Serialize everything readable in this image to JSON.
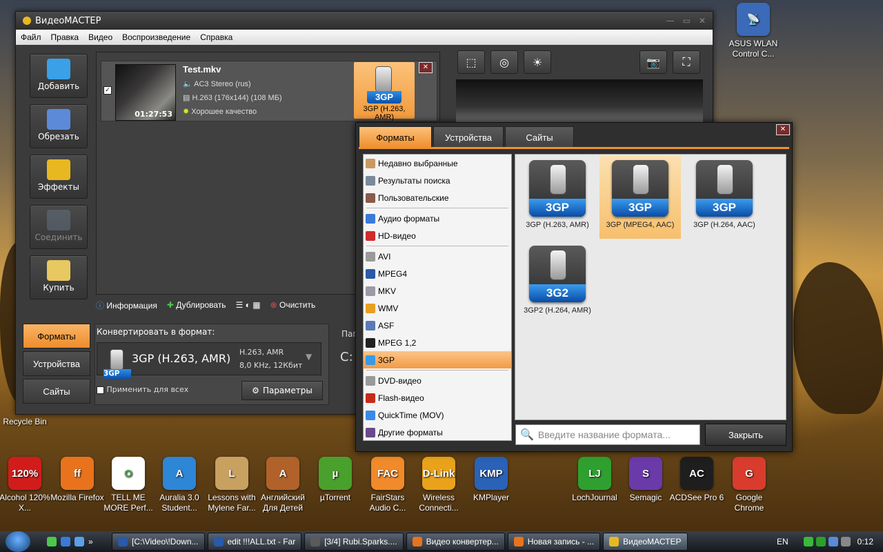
{
  "desktop": {
    "icons_top_right": [
      "ASUS WLAN Control C..."
    ],
    "icons_left": [
      "Recycle Bin"
    ],
    "icons_bottom": [
      {
        "label": "Alcohol 120% X...",
        "color": "#d21c1c",
        "glyph": "120%"
      },
      {
        "label": "Mozilla Firefox",
        "color": "#e8731c",
        "glyph": "ff"
      },
      {
        "label": "TELL ME MORE Perf...",
        "color": "#ffffff",
        "glyph": "O"
      },
      {
        "label": "Auralia 3.0 Student...",
        "color": "#2d86d6",
        "glyph": "A"
      },
      {
        "label": "Lessons with Mylene Far...",
        "color": "#c8a060",
        "glyph": "L"
      },
      {
        "label": "Английский Для Детей",
        "color": "#b0622a",
        "glyph": "A"
      },
      {
        "label": "µTorrent",
        "color": "#4aa02c",
        "glyph": "µ"
      },
      {
        "label": "FairStars Audio C...",
        "color": "#f08a2a",
        "glyph": "FAC"
      },
      {
        "label": "Wireless Connecti...",
        "color": "#e9a21a",
        "glyph": "D-Link"
      },
      {
        "label": "KMPlayer",
        "color": "#2a62b8",
        "glyph": "KMP"
      },
      {
        "label": "LochJournal",
        "color": "#2fa02f",
        "glyph": "LJ"
      },
      {
        "label": "Semagic",
        "color": "#6a3aa8",
        "glyph": "S"
      },
      {
        "label": "ACDSee Pro 6",
        "color": "#1e1e1e",
        "glyph": "AC"
      },
      {
        "label": "Google Chrome",
        "color": "#d93c2c",
        "glyph": "G"
      }
    ]
  },
  "main": {
    "title": "ВидеоМАСТЕР",
    "menu": [
      "Файл",
      "Правка",
      "Видео",
      "Воспроизведение",
      "Справка"
    ],
    "tools": [
      {
        "label": "Добавить",
        "color": "#3aa0e8",
        "enabled": true
      },
      {
        "label": "Обрезать",
        "color": "#5c8ad8",
        "enabled": true
      },
      {
        "label": "Эффекты",
        "color": "#e8b820",
        "enabled": true
      },
      {
        "label": "Соединить",
        "color": "#6a7a8a",
        "enabled": false
      },
      {
        "label": "Купить",
        "color": "#e8c860",
        "enabled": true
      }
    ],
    "file": {
      "name": "Test.mkv",
      "audio": "AC3 Stereo (rus)",
      "video": "H.263 (176x144) (108 МБ)",
      "quality": "Хорошее качество",
      "duration": "01:27:53"
    },
    "format_badge": {
      "label": "3GP (H.263, AMR)",
      "icon_text": "3GP"
    },
    "bottom_actions": [
      "Информация",
      "Дублировать",
      "Очистить"
    ],
    "conv_tabs": [
      "Форматы",
      "Устройства",
      "Сайты"
    ],
    "convert_label": "Конвертировать в формат:",
    "convert_format": "3GP (H.263, AMR)",
    "convert_codec": "H.263, AMR",
    "convert_audio": "8,0 KHz, 12Кбит",
    "apply_all": "Применить для всех",
    "params_button": "Параметры",
    "folder_partial": "Пап",
    "path_partial": "C:"
  },
  "dialog": {
    "tabs": [
      "Форматы",
      "Устройства",
      "Сайты"
    ],
    "categories": [
      {
        "label": "Недавно выбранные",
        "color": "#c89a60",
        "group": 1
      },
      {
        "label": "Результаты поиска",
        "color": "#7a8a9a",
        "group": 1
      },
      {
        "label": "Пользовательские",
        "color": "#8a5a4a",
        "group": 1
      },
      {
        "label": "Аудио форматы",
        "color": "#3a7ad8",
        "group": 2
      },
      {
        "label": "HD-видео",
        "color": "#d02a2a",
        "group": 2
      },
      {
        "label": "AVI",
        "color": "#9a9a9a",
        "group": 3
      },
      {
        "label": "MPEG4",
        "color": "#2a5aa8",
        "group": 3
      },
      {
        "label": "MKV",
        "color": "#9a9aa8",
        "group": 3
      },
      {
        "label": "WMV",
        "color": "#e8a020",
        "group": 3
      },
      {
        "label": "ASF",
        "color": "#5a7ab8",
        "group": 3
      },
      {
        "label": "MPEG 1,2",
        "color": "#222222",
        "group": 3
      },
      {
        "label": "3GP",
        "color": "#3a9ae8",
        "group": 3
      },
      {
        "label": "DVD-видео",
        "color": "#9a9a9a",
        "group": 4
      },
      {
        "label": "Flash-видео",
        "color": "#c82a1a",
        "group": 4
      },
      {
        "label": "QuickTime (MOV)",
        "color": "#3a8ae8",
        "group": 4
      },
      {
        "label": "Другие форматы",
        "color": "#6a4a8a",
        "group": 4
      }
    ],
    "selected_category": "3GP",
    "formats": [
      {
        "label": "3GP (H.263, AMR)",
        "icon_text": "3GP"
      },
      {
        "label": "3GP (MPEG4, AAC)",
        "icon_text": "3GP",
        "selected": true
      },
      {
        "label": "3GP (H.264, AAC)",
        "icon_text": "3GP"
      },
      {
        "label": "3GP2 (H.264, AMR)",
        "icon_text": "3G2"
      }
    ],
    "search_placeholder": "Введите название формата...",
    "close_label": "Закрыть"
  },
  "taskbar": {
    "tasks": [
      {
        "label": "[C:\\Video\\!Down...",
        "color": "#2a5aa8"
      },
      {
        "label": "edit !!!ALL.txt - Far",
        "color": "#2a5aa8"
      },
      {
        "label": "[3/4] Rubi.Sparks....",
        "color": "#5a5a5a"
      },
      {
        "label": "Видео конвертер...",
        "color": "#e8731c"
      },
      {
        "label": "Новая запись - ...",
        "color": "#e8731c"
      },
      {
        "label": "ВидеоМАСТЕР",
        "color": "#e8b820",
        "active": true
      }
    ],
    "lang": "EN",
    "time": "0:12"
  }
}
